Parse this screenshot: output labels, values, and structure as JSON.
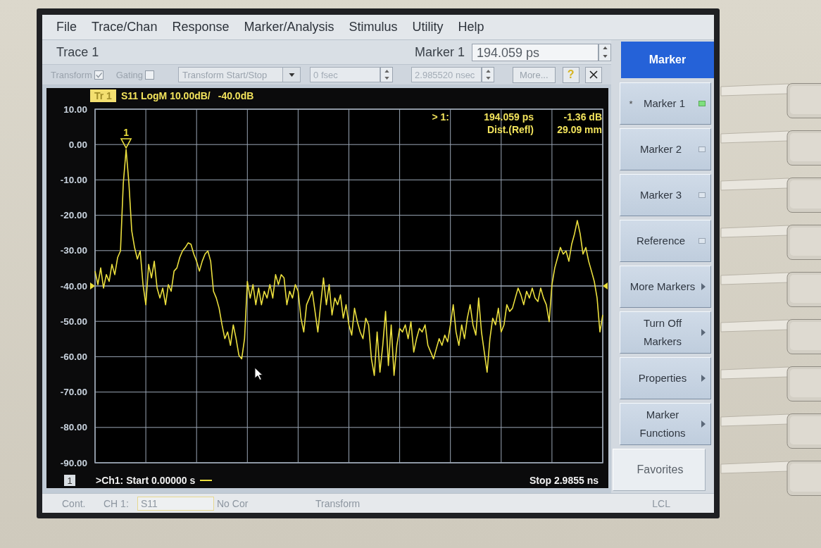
{
  "menu": [
    "File",
    "Trace/Chan",
    "Response",
    "Marker/Analysis",
    "Stimulus",
    "Utility",
    "Help"
  ],
  "trace_bar": {
    "trace_label": "Trace 1",
    "marker_label": "Marker 1",
    "marker_value": "194.059 ps"
  },
  "toolbar": {
    "items": [
      {
        "kind": "checkbox",
        "label": "Transform",
        "checked": true,
        "disabled": true
      },
      {
        "kind": "checkbox",
        "label": "Gating",
        "checked": false,
        "disabled": true
      },
      {
        "kind": "dropdown",
        "value": "Transform Start/Stop",
        "disabled": true
      },
      {
        "kind": "spin-field",
        "value": "0 fsec",
        "disabled": true
      },
      {
        "kind": "spin-field",
        "value": "2.985520 nsec",
        "disabled": true
      },
      {
        "kind": "button",
        "label": "More...",
        "disabled": true
      },
      {
        "kind": "help",
        "label": "?",
        "disabled": false
      },
      {
        "kind": "close",
        "disabled": false
      }
    ]
  },
  "chart": {
    "trace_tag": "Tr 1",
    "format": "S11 LogM 10.00dB/",
    "reference": "-40.0dB",
    "marker_readout": {
      "index": "> 1:",
      "stimulus": "194.059 ps",
      "response": "-1.36 dB",
      "distance_label": "Dist.(Refl)",
      "distance": "29.09 mm"
    },
    "channel": "1",
    "start": ">Ch1: Start 0.00000 s",
    "stop": "Stop 2.9855 ns",
    "chart_data": {
      "type": "line",
      "grid": true,
      "ylim": [
        -90,
        10
      ],
      "yticks": [
        {
          "value": 10,
          "label": "10.00"
        },
        {
          "value": 0,
          "label": "0.00"
        },
        {
          "value": -10,
          "label": "-10.00"
        },
        {
          "value": -20,
          "label": "-20.00"
        },
        {
          "value": -30,
          "label": "-30.00"
        },
        {
          "value": -40,
          "label": "-40.00"
        },
        {
          "value": -50,
          "label": "-50.00"
        },
        {
          "value": -60,
          "label": "-60.00"
        },
        {
          "value": -70,
          "label": "-70.00"
        },
        {
          "value": -80,
          "label": "-80.00"
        },
        {
          "value": -90,
          "label": "-90.00"
        }
      ],
      "values": [
        -35.8,
        -39.6,
        -34.9,
        -40.6,
        -36.8,
        -38.7,
        -33.9,
        -36.8,
        -32.0,
        -30.1,
        -11.0,
        -1.4,
        -11.0,
        -24.4,
        -29.1,
        -32.4,
        -30.1,
        -39.6,
        -45.3,
        -33.9,
        -37.7,
        -33.0,
        -40.6,
        -43.4,
        -40.6,
        -45.3,
        -39.6,
        -41.5,
        -35.8,
        -34.9,
        -32.0,
        -30.1,
        -29.1,
        -27.8,
        -28.2,
        -31.0,
        -33.0,
        -35.8,
        -33.0,
        -31.0,
        -30.1,
        -33.0,
        -41.5,
        -43.4,
        -46.3,
        -51.0,
        -54.9,
        -53.0,
        -56.8,
        -51.0,
        -54.9,
        -59.6,
        -60.6,
        -54.9,
        -38.7,
        -43.4,
        -39.6,
        -45.3,
        -40.6,
        -45.3,
        -41.5,
        -43.4,
        -39.6,
        -43.4,
        -36.8,
        -39.6,
        -36.8,
        -37.7,
        -45.3,
        -41.5,
        -43.4,
        -39.6,
        -41.5,
        -49.1,
        -53.0,
        -45.3,
        -43.4,
        -41.5,
        -47.2,
        -53.0,
        -45.3,
        -37.7,
        -45.3,
        -39.6,
        -48.2,
        -43.4,
        -45.3,
        -42.5,
        -49.1,
        -45.3,
        -51.0,
        -53.9,
        -46.3,
        -50.1,
        -53.0,
        -54.9,
        -49.1,
        -51.0,
        -60.6,
        -65.3,
        -53.0,
        -64.4,
        -56.8,
        -47.2,
        -62.5,
        -51.0,
        -65.3,
        -56.8,
        -52.0,
        -53.0,
        -51.0,
        -54.9,
        -50.1,
        -58.7,
        -54.9,
        -52.0,
        -53.0,
        -51.0,
        -56.8,
        -58.7,
        -60.6,
        -57.7,
        -54.9,
        -56.8,
        -53.9,
        -55.8,
        -51.0,
        -45.3,
        -53.0,
        -56.8,
        -51.0,
        -54.9,
        -49.1,
        -45.3,
        -51.0,
        -53.9,
        -43.4,
        -53.0,
        -58.7,
        -64.4,
        -54.9,
        -49.1,
        -51.0,
        -46.3,
        -53.0,
        -51.0,
        -45.3,
        -47.2,
        -46.3,
        -43.4,
        -40.6,
        -42.5,
        -45.3,
        -41.5,
        -43.4,
        -40.6,
        -43.4,
        -44.4,
        -40.6,
        -43.4,
        -45.3,
        -50.1,
        -39.6,
        -34.9,
        -32.0,
        -29.1,
        -31.0,
        -30.1,
        -33.0,
        -28.2,
        -25.3,
        -21.5,
        -25.3,
        -31.0,
        -29.1,
        -33.0,
        -35.8,
        -38.7,
        -43.4,
        -53.0,
        -48.2
      ],
      "annotations": [
        {
          "text": "1",
          "y": -1.36
        }
      ],
      "ref_lines": [
        {
          "axis": "y",
          "value": -40
        }
      ]
    }
  },
  "softkey_panel": {
    "title": "Marker",
    "keys": [
      {
        "kind": "toggle",
        "prefix": "*",
        "label": "Marker 1",
        "on": true
      },
      {
        "kind": "toggle",
        "label": "Marker 2",
        "on": false
      },
      {
        "kind": "toggle",
        "label": "Marker 3",
        "on": false
      },
      {
        "kind": "toggle",
        "label": "Reference",
        "on": false
      },
      {
        "kind": "submenu",
        "label": "More Markers"
      },
      {
        "kind": "submenu",
        "label": "Turn Off\nMarkers"
      },
      {
        "kind": "submenu",
        "label": "Properties"
      },
      {
        "kind": "submenu",
        "label": "Marker\nFunctions"
      },
      {
        "kind": "plain",
        "label": "Favorites"
      }
    ]
  },
  "status_bar": [
    {
      "kind": "text",
      "text": "Cont."
    },
    {
      "kind": "text",
      "text": "CH 1:"
    },
    {
      "kind": "field",
      "text": "S11"
    },
    {
      "kind": "text",
      "text": "No Cor"
    },
    {
      "kind": "text",
      "text": "Transform"
    },
    {
      "kind": "text",
      "text": "LCL"
    }
  ]
}
